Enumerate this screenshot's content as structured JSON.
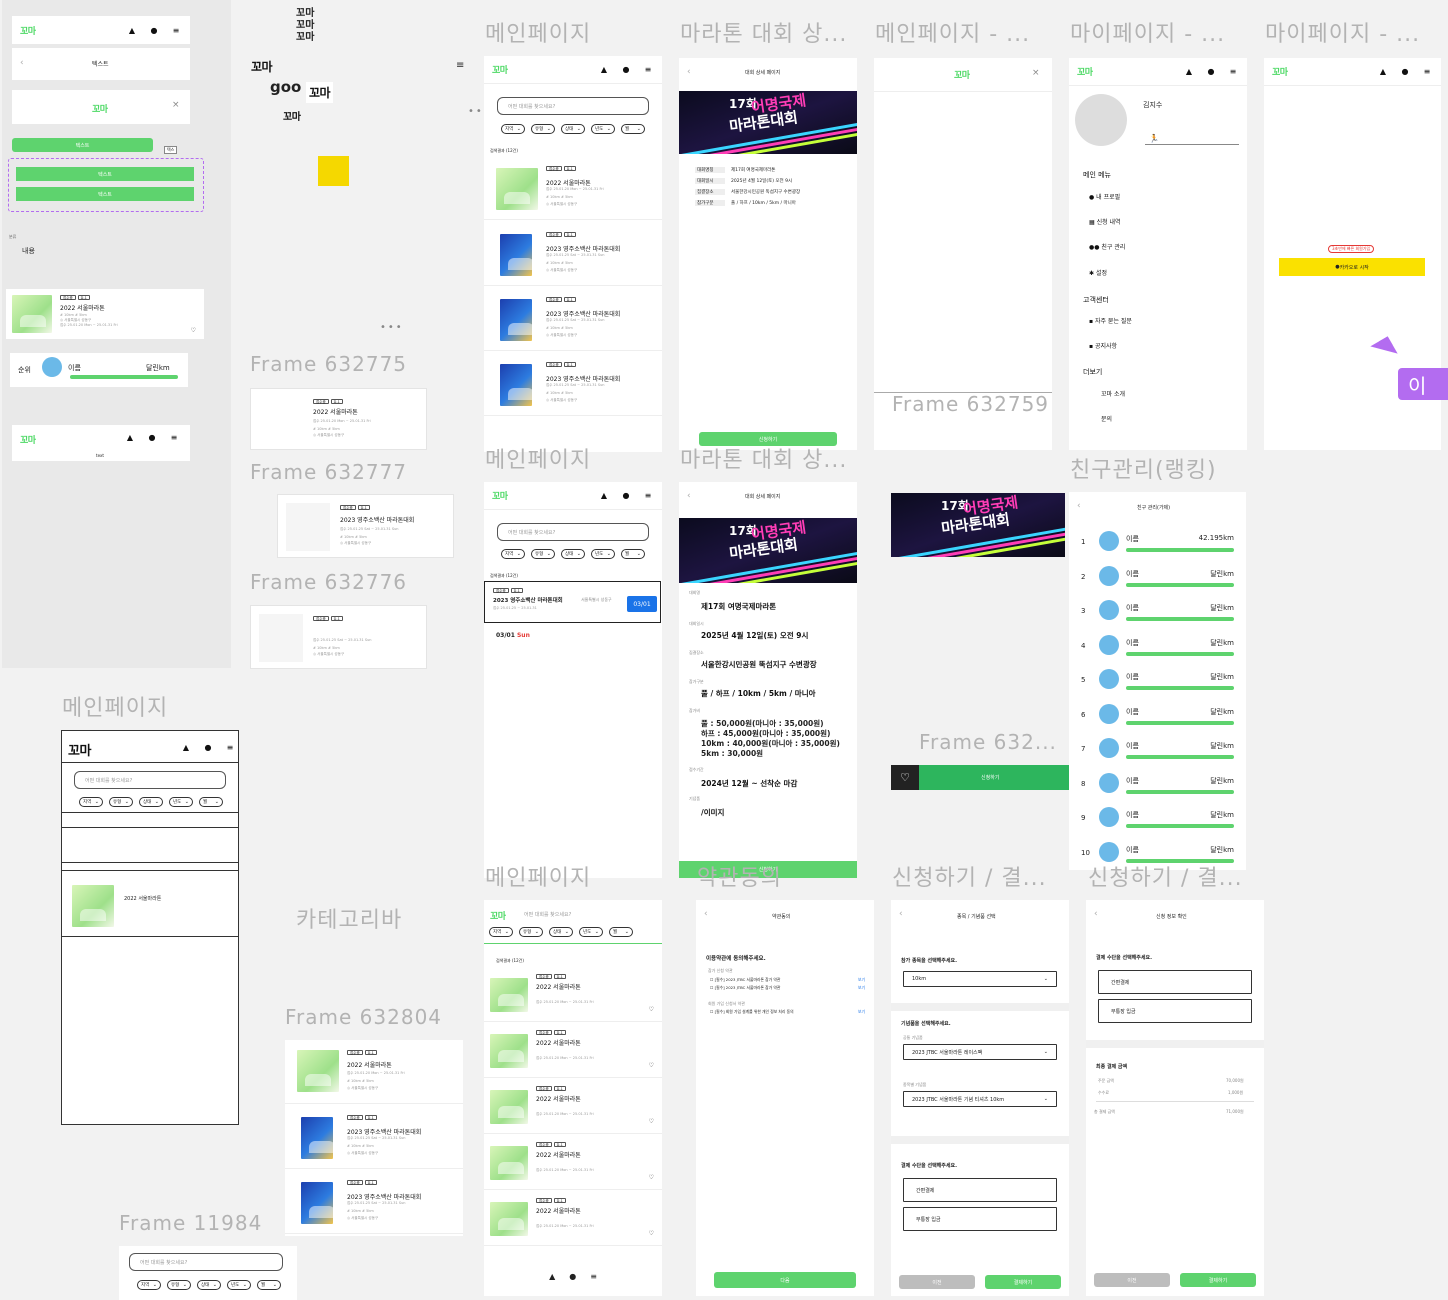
{
  "colors": {
    "brand": "#4cd964",
    "button": "#5ed36e",
    "kakao": "#fae100",
    "cursor": "#b36cf0",
    "blue": "#1a73e8"
  },
  "logo": "꼬마",
  "logo_variants": [
    "꼬마",
    "꼬마",
    "꼬마"
  ],
  "logo_goo": "goo",
  "titles": {
    "main1": "메인페이지",
    "detail1": "마라톤 대회 상...",
    "main_edit": "메인페이지 - ...",
    "my1": "마이페이지 - ...",
    "my2": "마이페이지 - ...",
    "main2": "메인페이지",
    "detail2": "마라톤 대회 상...",
    "friends": "친구관리(랭킹)",
    "main_left": "메인페이지",
    "catbar": "카테고리바",
    "main3": "메인페이지",
    "terms": "약관동의",
    "apply1": "신청하기 / 결...",
    "apply2": "신청하기 / 결...",
    "f632775": "Frame 632775",
    "f632777": "Frame 632777",
    "f632776": "Frame 632776",
    "f632759": "Frame 632759",
    "f632x": "Frame 632...",
    "f632804": "Frame 632804",
    "f11984": "Frame 11984"
  },
  "components": {
    "text": "텍스트",
    "category": "분류",
    "content": "내용",
    "rank": "순위",
    "name": "이름",
    "run_km": "달린km",
    "text_small": "text",
    "small_tag": "텍스"
  },
  "search_placeholder": "어떤 대회를 찾으세요?",
  "filters": [
    "지역",
    "유형",
    "상태",
    "년도",
    "월"
  ],
  "list_count": "검색결과 (12건)",
  "race_seoul": "2022 서울마라톤",
  "race_yeongju": "2023 영주소백산 마라톤대회",
  "tags_a": [
    "접수중",
    "D-1"
  ],
  "meta_dist": "# 10km # 5km",
  "meta_place": "◎ 서울특별시 성동구",
  "meta_date_a": "접수 25.01.20 Mon ~ 25.01.31 Fri",
  "meta_date_b": "접수 25.01.25 Sat ~ 25.01.31 Sun",
  "detail": {
    "header": "대회 상세 페이지",
    "poster_a": "17회",
    "poster_b": "어명국제",
    "poster_c": "마라톤대회",
    "rows": [
      [
        "대회명칭",
        "제17회 여명국제마라톤"
      ],
      [
        "대회일시",
        "2025년 4월 12일(토) 오전 9시"
      ],
      [
        "집결장소",
        "서울한강시민공원 뚝섬지구 수변광장"
      ],
      [
        "참가구분",
        "풀 / 하프 / 10km / 5km / 마니아"
      ]
    ],
    "apply": "신청하기",
    "labels": [
      "대회명",
      "대회일시",
      "집결장소",
      "참가구분",
      "참가비",
      "접수기간",
      "기념품"
    ],
    "values": [
      "제17회 여명국제마라톤",
      "2025년 4월 12일(토) 오전 9시",
      "서울한강시민공원 뚝섬지구 수변광장",
      "풀 / 하프 / 10km / 5km / 마니아"
    ],
    "fees": [
      "풀 : 50,000원(마니아 : 35,000원)",
      "하프 : 45,000원(마니아 : 35,000원)",
      "10km : 40,000원(마니아 : 35,000원)",
      "5km : 30,000원"
    ],
    "period": "2024년 12월 ~ 선착순 마감",
    "gift": "/이미지"
  },
  "calendar": {
    "race": "2023 영주소백산 마라톤대회",
    "place": "서울특별시 성동구",
    "range": "접수 25.01.25 ~ 25.01.31",
    "badge": "03/01",
    "date": "03/01 Sun"
  },
  "mypage": {
    "name": "김지수",
    "menu": "메인 메뉴",
    "items": [
      "내 프로필",
      "신청 내역",
      "친구 관리",
      "설정"
    ],
    "cs": "고객센터",
    "cs_items": [
      "자주 묻는 질문",
      "공지사항"
    ],
    "more": "더보기",
    "more_items": [
      "꼬마 소개",
      "문의"
    ]
  },
  "login": {
    "tooltip": "3초만에 빠른 회원가입",
    "kakao": "카카오로 시작",
    "drag_label": "이재"
  },
  "friends": {
    "header": "친구 관리(가제)",
    "first_km": "42.195km",
    "ranks": [
      "1",
      "2",
      "3",
      "4",
      "5",
      "6",
      "7",
      "8",
      "9",
      "10"
    ]
  },
  "terms": {
    "header": "약관동의",
    "title": "이용약관에 동의해주세요.",
    "group1": "참가 신청 약관",
    "items": [
      "[필수] 2023 JTBC 서울마라톤 참가 약관",
      "[필수] 2023 JTBC 서울마라톤 참가 약관"
    ],
    "group2": "회원 가입 신청서 약관",
    "item3": "[필수] 회원 가입 설계를 위한 개인 정보 처리 동의",
    "see": "보기",
    "next": "다음"
  },
  "select": {
    "header": "종목 / 기념품 선택",
    "q1": "참가 종목을 선택해주세요.",
    "event": "10km",
    "q2": "기념품을 선택해주세요.",
    "gift_lbl1": "공통 기념품",
    "gift1": "2023 JTBC 서울마라톤 레이스팩",
    "gift_lbl2": "종목별 기념품",
    "gift2": "2023 JTBC 서울마라톤 기념 티셔츠 10km",
    "q3": "결제 수단을 선택해주세요.",
    "pay1": "간편결제",
    "pay2": "무통장 입금",
    "prev": "이전",
    "pay": "결제하기"
  },
  "confirm": {
    "header": "신청 정보 확인",
    "q": "결제 수단을 선택해주세요.",
    "pay1": "간편결제",
    "pay2": "무통장 입금",
    "total_title": "최종 결제 금액",
    "rows": [
      [
        "주문 금액",
        "70,000원"
      ],
      [
        "수수료",
        "1,000원"
      ],
      [
        "총 결제 금액",
        "71,000원"
      ]
    ],
    "prev": "이전",
    "pay": "결제하기"
  }
}
